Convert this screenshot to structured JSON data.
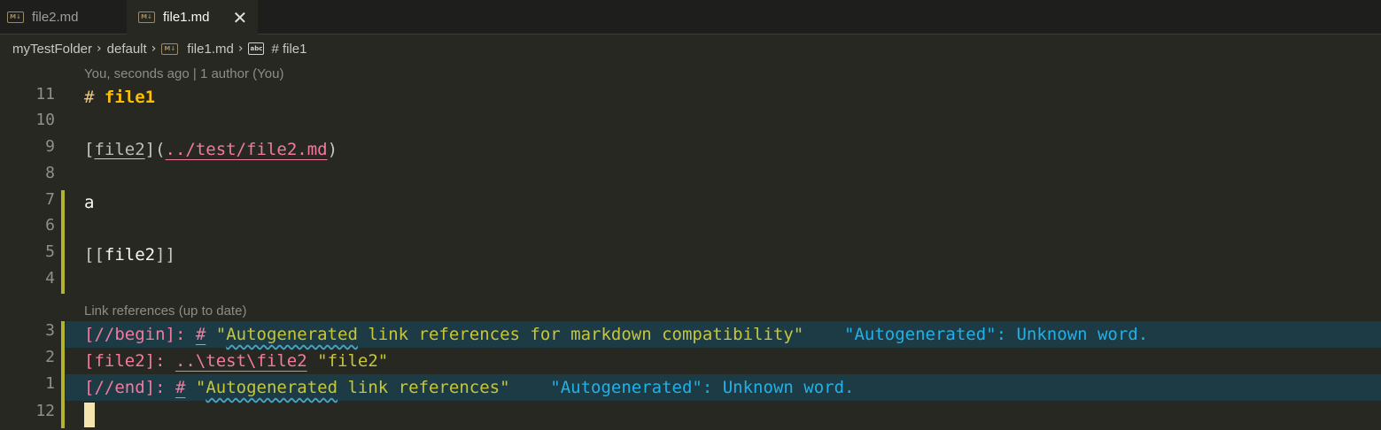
{
  "tabs": [
    {
      "label": "file2.md",
      "icon": "markdown-icon",
      "active": false
    },
    {
      "label": "file1.md",
      "icon": "markdown-icon",
      "active": true,
      "close": "✕"
    }
  ],
  "breadcrumb": {
    "folder": "myTestFolder",
    "subfolder": "default",
    "file": "file1.md",
    "symbol": "# file1"
  },
  "codelens": {
    "blame": "You, seconds ago | 1 author (You)",
    "refs": "Link references (up to date)"
  },
  "gutter": [
    "11",
    "10",
    "9",
    "8",
    "7",
    "6",
    "5",
    "4",
    "3",
    "2",
    "1",
    "12"
  ],
  "editor": {
    "l11": {
      "hash": "#",
      "text": "file1"
    },
    "l9": {
      "open": "[",
      "link": "file2",
      "mid": "](",
      "url": "../test/file2.md",
      "close": ")"
    },
    "l7": {
      "text": "a"
    },
    "l5": {
      "open": "[[",
      "text": "file2",
      "close": "]]"
    },
    "l3": {
      "key": "[//begin]:",
      "hash": "#",
      "q1": "\"",
      "word": "Autogenerated",
      "rest": " link references for markdown compatibility\"",
      "diag": "\"Autogenerated\": Unknown word."
    },
    "l2": {
      "key": "[file2]:",
      "path": "..\\test\\file2",
      "title": "\"file2\""
    },
    "l1": {
      "key": "[//end]:",
      "hash": "#",
      "q1": "\"",
      "word": "Autogenerated",
      "rest": " link references\"",
      "diag": "\"Autogenerated\": Unknown word."
    }
  },
  "colors": {
    "background": "#272822",
    "heading": "#fdbf00",
    "link": "#f27aa0",
    "string": "#c7c63b",
    "diagnostic": "#22b0e8",
    "git_modified": "#b3b32e"
  }
}
